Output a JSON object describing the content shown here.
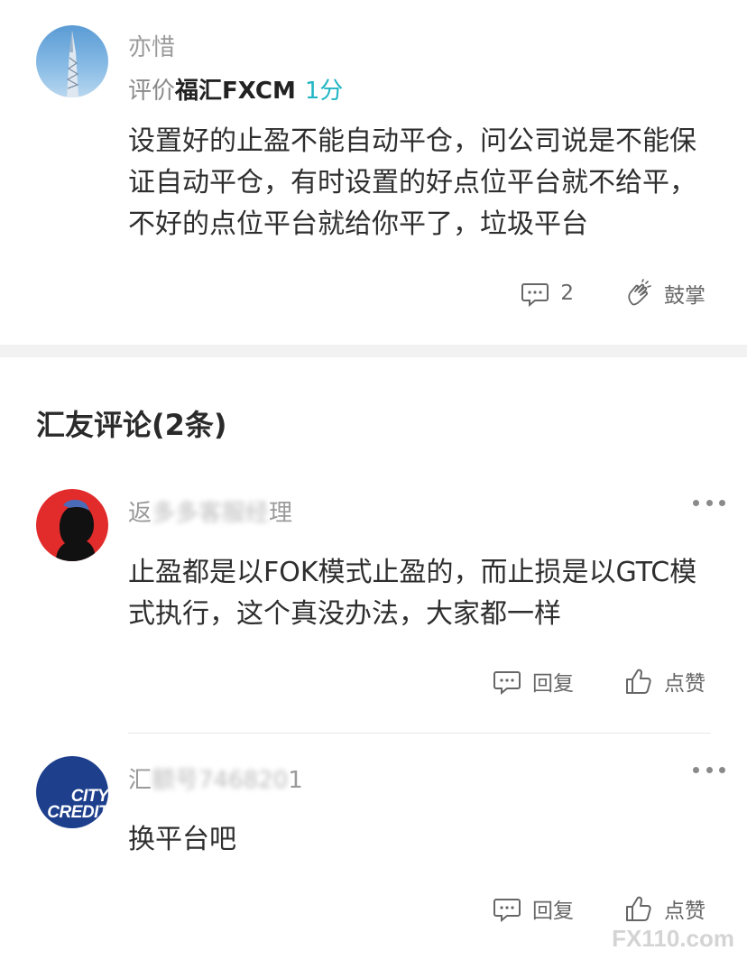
{
  "post": {
    "username": "亦惜",
    "rating_prefix": "评价",
    "broker": "福汇FXCM",
    "score": "1分",
    "content": "设置好的止盈不能自动平仓，问公司说是不能保证自动平仓，有时设置的好点位平台就不给平，不好的点位平台就给你平了，垃圾平台",
    "comment_count": "2",
    "applaud_label": "鼓掌"
  },
  "section_title": "汇友评论(2条)",
  "comments": [
    {
      "name_start": "返",
      "name_hidden": "多多客服经",
      "name_end": "理",
      "content": "止盈都是以FOK模式止盈的，而止损是以GTC模式执行，这个真没办法，大家都一样",
      "reply_label": "回复",
      "like_label": "点赞"
    },
    {
      "name_start": "汇",
      "name_hidden": "额号746820",
      "name_end": "1",
      "avatar_text_1": "CITY",
      "avatar_text_2": "CREDIT",
      "content": "换平台吧",
      "reply_label": "回复",
      "like_label": "点赞"
    }
  ],
  "watermark": "FX110.com"
}
